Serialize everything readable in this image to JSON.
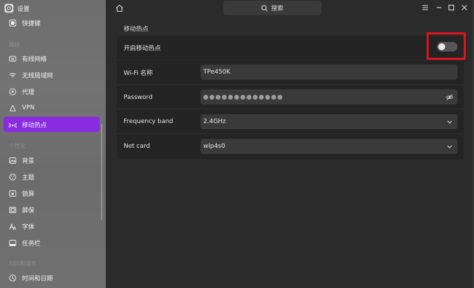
{
  "sidebar": {
    "title": "设置",
    "items": {
      "shortcuts": "快捷键",
      "wired": "有线网络",
      "wireless": "无线局域网",
      "proxy": "代理",
      "vpn": "VPN",
      "hotspot": "移动热点",
      "background": "背景",
      "theme": "主题",
      "lockscreen": "锁屏",
      "screensaver": "屏保",
      "font": "字体",
      "taskbar": "任务栏",
      "datetime": "时间和日期"
    },
    "sections": {
      "network": "网络",
      "personalize": "个性化",
      "time_language": "时间和语言"
    }
  },
  "topbar": {
    "search_label": "搜索"
  },
  "main": {
    "section_title": "移动热点",
    "enable_label": "开启移动热点",
    "enable_state": false,
    "wifi_name_label": "Wi-Fi 名称",
    "wifi_name_value": "TPe450K",
    "password_label": "Password",
    "password_mask_length": 13,
    "band_label": "Frequency band",
    "band_value": "2.4GHz",
    "netcard_label": "Net card",
    "netcard_value": "wlp4s0"
  },
  "colors": {
    "accent": "#8a2be2",
    "highlight": "#e3121b"
  }
}
